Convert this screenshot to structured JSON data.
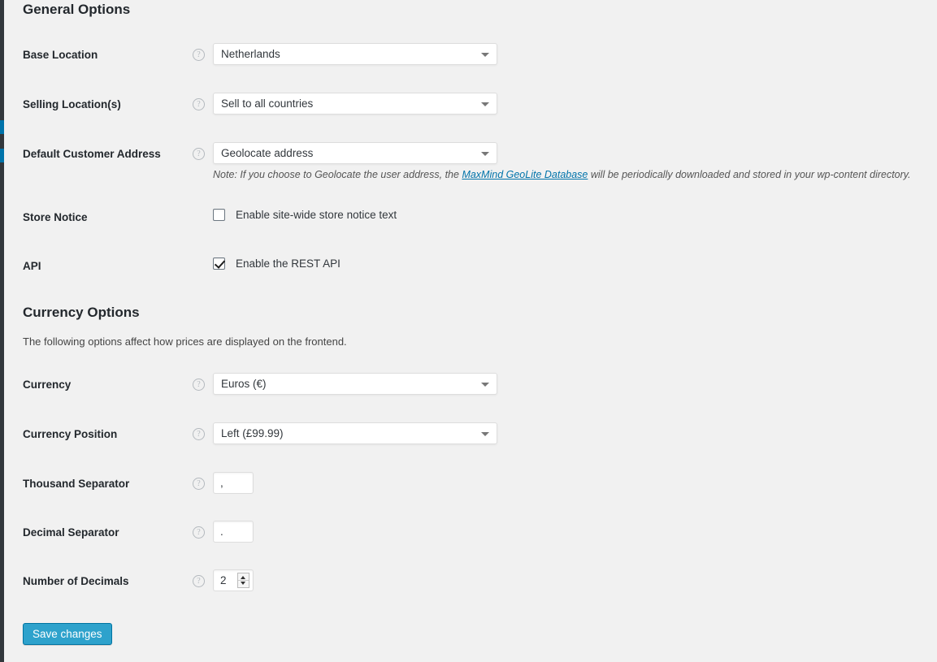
{
  "general": {
    "title": "General Options",
    "rows": [
      {
        "label": "Base Location",
        "help": "?",
        "value": "Netherlands"
      },
      {
        "label": "Selling Location(s)",
        "help": "?",
        "value": "Sell to all countries"
      },
      {
        "label": "Default Customer Address",
        "help": "?",
        "value": "Geolocate address",
        "note_before": "Note: If you choose to Geolocate the user address, the ",
        "note_link": "MaxMind GeoLite Database",
        "note_after": " will be periodically downloaded and stored in your wp-content directory."
      }
    ],
    "store_notice": {
      "label": "Store Notice",
      "checkbox_label": "Enable site-wide store notice text",
      "checked": false
    },
    "api": {
      "label": "API",
      "checkbox_label": "Enable the REST API",
      "checked": true
    }
  },
  "currency": {
    "title": "Currency Options",
    "intro": "The following options affect how prices are displayed on the frontend.",
    "rows": [
      {
        "label": "Currency",
        "help": "?",
        "value": "Euros (€)"
      },
      {
        "label": "Currency Position",
        "help": "?",
        "value": "Left (£99.99)"
      }
    ],
    "thousand_separator": {
      "label": "Thousand Separator",
      "help": "?",
      "value": ","
    },
    "decimal_separator": {
      "label": "Decimal Separator",
      "help": "?",
      "value": "."
    },
    "number_of_decimals": {
      "label": "Number of Decimals",
      "help": "?",
      "value": "2"
    }
  },
  "footer": {
    "save_label": "Save changes"
  },
  "colors": {
    "accent": "#2ea2cc",
    "link": "#0073aa",
    "background": "#f1f1f1",
    "rail": "#32373c",
    "label_text": "#23282d"
  }
}
